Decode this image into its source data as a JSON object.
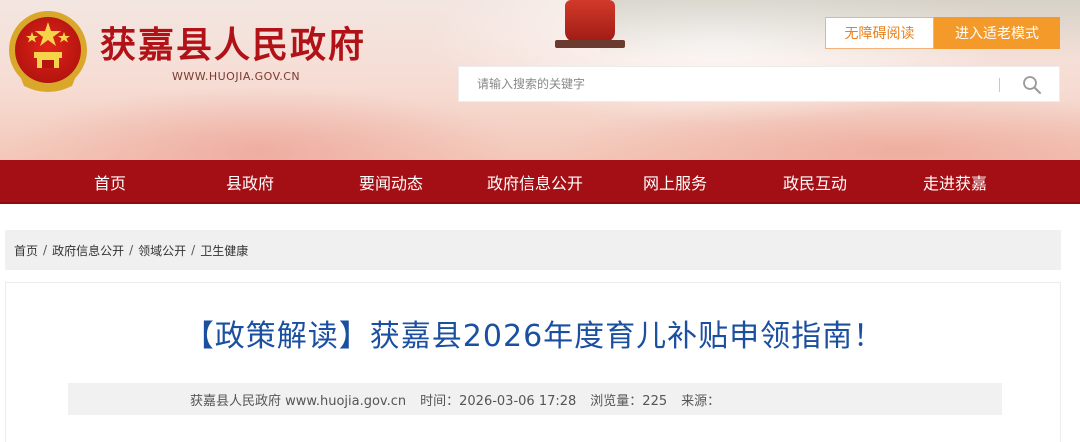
{
  "header": {
    "site_name": "获嘉县人民政府",
    "site_url": "WWW.HUOJIA.GOV.CN",
    "emblem": "national-emblem",
    "accessibility_label": "无障碍阅读",
    "elder_mode_label": "进入适老模式",
    "search": {
      "placeholder": "请输入搜索的关键字",
      "icon": "search-icon"
    }
  },
  "nav": {
    "items": [
      {
        "label": "首页"
      },
      {
        "label": "县政府"
      },
      {
        "label": "要闻动态"
      },
      {
        "label": "政府信息公开"
      },
      {
        "label": "网上服务"
      },
      {
        "label": "政民互动"
      },
      {
        "label": "走进获嘉"
      }
    ]
  },
  "breadcrumb": {
    "items": [
      "首页",
      "政府信息公开",
      "领域公开",
      "卫生健康"
    ],
    "separator": "/"
  },
  "article": {
    "title": "【政策解读】获嘉县2026年度育儿补贴申领指南！",
    "meta": {
      "publisher": "获嘉县人民政府 www.huojia.gov.cn",
      "time": "时间：2026-03-06 17:28",
      "views": "浏览量：225",
      "source": "来源："
    }
  },
  "colors": {
    "brand_red": "#a30f14",
    "title_blue": "#1b4fa0",
    "accent_orange": "#f39a2a"
  }
}
